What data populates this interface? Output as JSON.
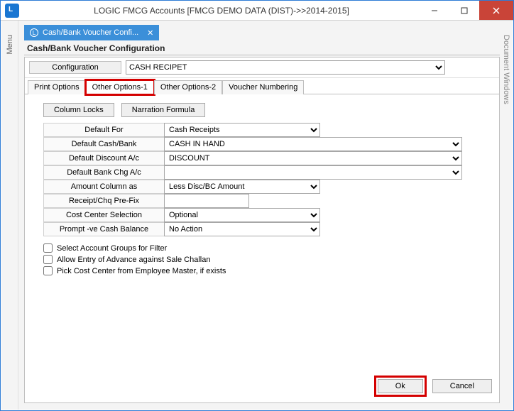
{
  "window": {
    "title": "LOGIC FMCG Accounts  [FMCG DEMO DATA (DIST)->>2014-2015]"
  },
  "left_rail": "Menu",
  "right_rail": "Document Windows",
  "doc_tab": {
    "label": "Cash/Bank Voucher Confi..."
  },
  "page_title": "Cash/Bank Voucher Configuration",
  "config": {
    "label": "Configuration",
    "value": "CASH RECIPET"
  },
  "tabs": {
    "t0": "Print Options",
    "t1": "Other Options-1",
    "t2": "Other Options-2",
    "t3": "Voucher Numbering"
  },
  "buttons": {
    "col_locks": "Column Locks",
    "narration": "Narration Formula",
    "ok": "Ok",
    "cancel": "Cancel"
  },
  "form": {
    "default_for": {
      "label": "Default For",
      "value": "Cash Receipts"
    },
    "default_cash_bank": {
      "label": "Default Cash/Bank",
      "value": "CASH IN HAND"
    },
    "default_discount": {
      "label": "Default Discount A/c",
      "value": "DISCOUNT"
    },
    "default_bank_chg": {
      "label": "Default Bank Chg A/c",
      "value": ""
    },
    "amount_col": {
      "label": "Amount Column as",
      "value": "Less Disc/BC Amount"
    },
    "receipt_prefix": {
      "label": "Receipt/Chq Pre-Fix",
      "value": ""
    },
    "cost_center": {
      "label": "Cost Center Selection",
      "value": "Optional"
    },
    "neg_cash": {
      "label": "Prompt -ve Cash Balance",
      "value": "No Action"
    }
  },
  "checks": {
    "c0": "Select Account Groups for Filter",
    "c1": "Allow Entry of Advance against Sale Challan",
    "c2": "Pick Cost Center from Employee Master, if exists"
  }
}
